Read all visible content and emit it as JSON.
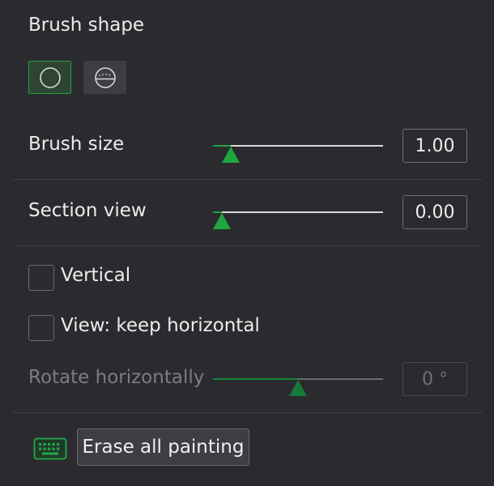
{
  "brush_shape": {
    "label": "Brush shape",
    "options": [
      {
        "icon": "circle-icon",
        "selected": true
      },
      {
        "icon": "sphere-icon",
        "selected": false
      }
    ]
  },
  "brush_size": {
    "label": "Brush size",
    "value": "1.00",
    "fraction": 0.06
  },
  "section_view": {
    "label": "Section view",
    "value": "0.00",
    "fraction": 0.0
  },
  "vertical": {
    "label": "Vertical",
    "checked": false
  },
  "keep_horizontal": {
    "label": "View: keep horizontal",
    "checked": false
  },
  "rotate_horizontally": {
    "label": "Rotate horizontally",
    "value": "0 °",
    "fraction": 0.5,
    "enabled": false
  },
  "erase": {
    "label": "Erase all painting",
    "icon": "keyboard-icon"
  },
  "colors": {
    "accent": "#21a141",
    "background": "#2b2b2f"
  }
}
